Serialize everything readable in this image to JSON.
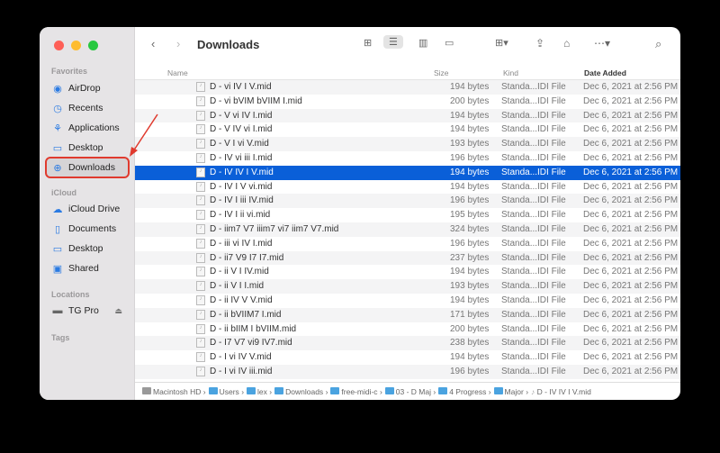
{
  "window": {
    "title": "Downloads"
  },
  "sidebar": {
    "favorites_label": "Favorites",
    "favorites": [
      {
        "label": "AirDrop",
        "icon": "airdrop-icon"
      },
      {
        "label": "Recents",
        "icon": "clock-icon"
      },
      {
        "label": "Applications",
        "icon": "applications-icon"
      },
      {
        "label": "Desktop",
        "icon": "desktop-icon"
      },
      {
        "label": "Downloads",
        "icon": "download-icon",
        "selected": true
      }
    ],
    "icloud_label": "iCloud",
    "icloud": [
      {
        "label": "iCloud Drive",
        "icon": "cloud-icon"
      },
      {
        "label": "Documents",
        "icon": "document-icon"
      },
      {
        "label": "Desktop",
        "icon": "desktop-icon"
      },
      {
        "label": "Shared",
        "icon": "shared-folder-icon"
      }
    ],
    "locations_label": "Locations",
    "locations": [
      {
        "label": "TG Pro",
        "icon": "disk-icon"
      }
    ],
    "tags_label": "Tags"
  },
  "columns": {
    "name": "Name",
    "size": "Size",
    "kind": "Kind",
    "date": "Date Added"
  },
  "files": [
    {
      "name": "D - vi IV I V.mid",
      "size": "194 bytes",
      "kind": "Standa...IDI File",
      "date": "Dec 6, 2021 at 2:56 PM"
    },
    {
      "name": "D - vi bVIM bVIIM I.mid",
      "size": "200 bytes",
      "kind": "Standa...IDI File",
      "date": "Dec 6, 2021 at 2:56 PM"
    },
    {
      "name": "D - V vi IV I.mid",
      "size": "194 bytes",
      "kind": "Standa...IDI File",
      "date": "Dec 6, 2021 at 2:56 PM"
    },
    {
      "name": "D - V IV vi I.mid",
      "size": "194 bytes",
      "kind": "Standa...IDI File",
      "date": "Dec 6, 2021 at 2:56 PM"
    },
    {
      "name": "D - V I vi V.mid",
      "size": "193 bytes",
      "kind": "Standa...IDI File",
      "date": "Dec 6, 2021 at 2:56 PM"
    },
    {
      "name": "D - IV vi iii I.mid",
      "size": "196 bytes",
      "kind": "Standa...IDI File",
      "date": "Dec 6, 2021 at 2:56 PM"
    },
    {
      "name": "D - IV IV I V.mid",
      "size": "194 bytes",
      "kind": "Standa...IDI File",
      "date": "Dec 6, 2021 at 2:56 PM",
      "selected": true
    },
    {
      "name": "D - IV I V vi.mid",
      "size": "194 bytes",
      "kind": "Standa...IDI File",
      "date": "Dec 6, 2021 at 2:56 PM"
    },
    {
      "name": "D - IV I iii IV.mid",
      "size": "196 bytes",
      "kind": "Standa...IDI File",
      "date": "Dec 6, 2021 at 2:56 PM"
    },
    {
      "name": "D - IV I ii vi.mid",
      "size": "195 bytes",
      "kind": "Standa...IDI File",
      "date": "Dec 6, 2021 at 2:56 PM"
    },
    {
      "name": "D - iim7 V7 iiim7 vi7 iim7 V7.mid",
      "size": "324 bytes",
      "kind": "Standa...IDI File",
      "date": "Dec 6, 2021 at 2:56 PM"
    },
    {
      "name": "D - iii vi IV I.mid",
      "size": "196 bytes",
      "kind": "Standa...IDI File",
      "date": "Dec 6, 2021 at 2:56 PM"
    },
    {
      "name": "D - ii7 V9 I7 I7.mid",
      "size": "237 bytes",
      "kind": "Standa...IDI File",
      "date": "Dec 6, 2021 at 2:56 PM"
    },
    {
      "name": "D - ii V I IV.mid",
      "size": "194 bytes",
      "kind": "Standa...IDI File",
      "date": "Dec 6, 2021 at 2:56 PM"
    },
    {
      "name": "D - ii V I I.mid",
      "size": "193 bytes",
      "kind": "Standa...IDI File",
      "date": "Dec 6, 2021 at 2:56 PM"
    },
    {
      "name": "D - ii IV V V.mid",
      "size": "194 bytes",
      "kind": "Standa...IDI File",
      "date": "Dec 6, 2021 at 2:56 PM"
    },
    {
      "name": "D - ii bVIIM7 I.mid",
      "size": "171 bytes",
      "kind": "Standa...IDI File",
      "date": "Dec 6, 2021 at 2:56 PM"
    },
    {
      "name": "D - ii bIIM I bVIIM.mid",
      "size": "200 bytes",
      "kind": "Standa...IDI File",
      "date": "Dec 6, 2021 at 2:56 PM"
    },
    {
      "name": "D - I7 V7 vi9 IV7.mid",
      "size": "238 bytes",
      "kind": "Standa...IDI File",
      "date": "Dec 6, 2021 at 2:56 PM"
    },
    {
      "name": "D - I vi IV V.mid",
      "size": "194 bytes",
      "kind": "Standa...IDI File",
      "date": "Dec 6, 2021 at 2:56 PM"
    },
    {
      "name": "D - I vi IV iii.mid",
      "size": "196 bytes",
      "kind": "Standa...IDI File",
      "date": "Dec 6, 2021 at 2:56 PM"
    }
  ],
  "pathbar": [
    "Macintosh HD",
    "Users",
    "lex",
    "Downloads",
    "free-midi-c",
    "03 - D Maj",
    "4 Progress",
    "Major",
    "D - IV IV I V.mid"
  ],
  "colors": {
    "selection": "#0a5fd8",
    "highlight_box": "#e03a2e",
    "accent": "#2a7ae2"
  }
}
